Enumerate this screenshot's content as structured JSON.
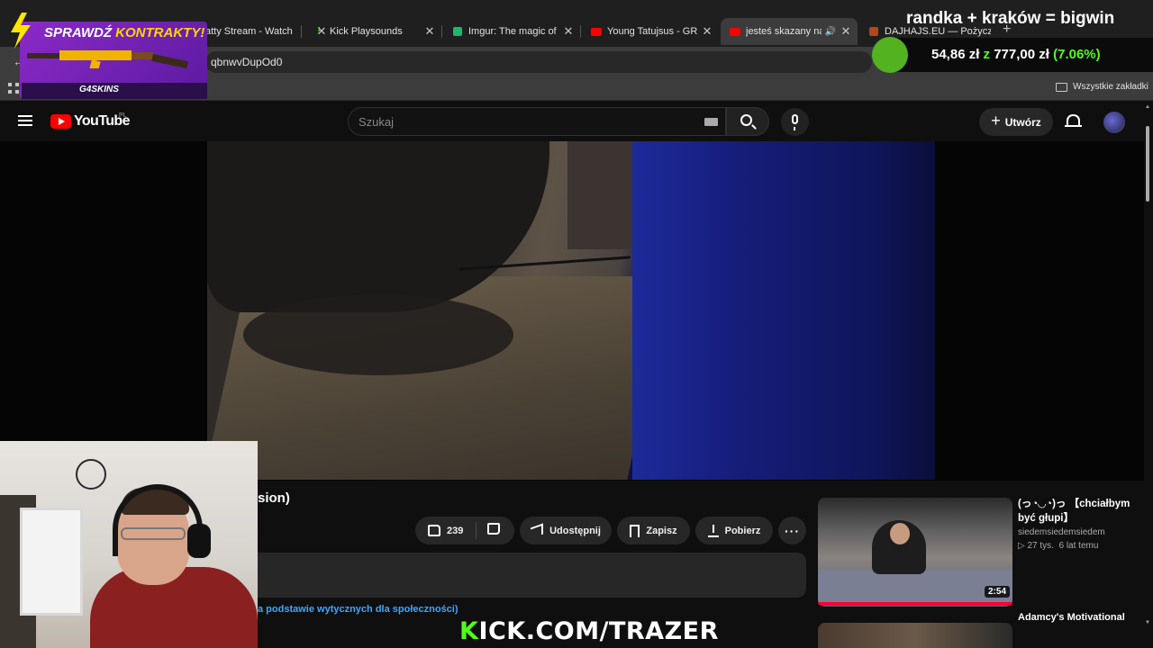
{
  "browser": {
    "tabs": [
      {
        "title": "atty Stream - Watch",
        "favicon": "stream-icon",
        "active": false
      },
      {
        "title": "Kick Playsounds",
        "favicon": "kick-icon",
        "active": false
      },
      {
        "title": "Imgur: The magic of the",
        "favicon": "imgur-icon",
        "active": false
      },
      {
        "title": "Young Tatujsus - GRECK",
        "favicon": "youtube-icon",
        "active": false
      },
      {
        "title": "jesteś skazany na cu",
        "favicon": "youtube-icon",
        "active": true,
        "audio": true
      },
      {
        "title": "DAJHAJS.EU — Pożyczk",
        "favicon": "dajhajs-icon",
        "active": false
      }
    ],
    "new_tab_label": "+",
    "url_fragment": "qbnwvDupOd0",
    "bookmarks_all_label": "Wszystkie zakładki"
  },
  "youtube": {
    "logo_text": "YouTube",
    "region": "PL",
    "search_placeholder": "Szukaj",
    "create_label": "Utwórz",
    "video_title_fragment": "sion)",
    "actions": {
      "like_count": "239",
      "share_label": "Udostępnij",
      "save_label": "Zapisz",
      "download_label": "Pobierz",
      "more_label": "···"
    },
    "guideline_text": "a podstawie wytycznych dla społeczności)",
    "recommendations": [
      {
        "title": "(っ◔◡◔)っ 【chciałbym być głupi】",
        "channel": "siedemsiedemsiedem",
        "views": "▷ 27 tys.",
        "age": "6 lat temu",
        "duration": "2:54",
        "watched_fraction": 1.0
      },
      {
        "title": "Adamcy's Motivational"
      }
    ]
  },
  "overlay": {
    "promo": {
      "title_part1": "SPRAWDŹ ",
      "title_part2": "KONTRAKTY!",
      "brand": "G4SKINS"
    },
    "stream_title": "randka + kraków = bigwin",
    "stats": {
      "current": "54,86 zł",
      "separator": "z",
      "total": "777,00 zł",
      "percent": "(7.06%)"
    },
    "banner_k": "K",
    "banner_rest": "ICK.COM/TRAZER"
  },
  "colors": {
    "kick_green": "#53fc18",
    "youtube_red": "#ff0000",
    "promo_purple": "#8a2ac8",
    "link_blue": "#3ea6ff"
  }
}
